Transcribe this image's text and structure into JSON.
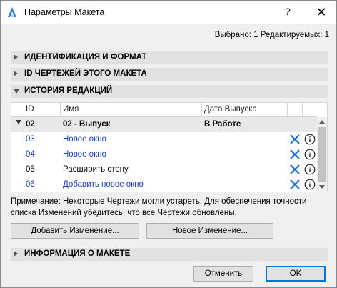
{
  "window": {
    "title": "Параметры Макета",
    "help_label": "?",
    "close_label": "✕"
  },
  "selection_info": "Выбрано: 1 Редактируемых: 1",
  "sections": [
    {
      "label": "ИДЕНТИФИКАЦИЯ И ФОРМАТ",
      "expanded": false
    },
    {
      "label": "ID ЧЕРТЕЖЕЙ ЭТОГО МАКЕТА",
      "expanded": false
    },
    {
      "label": "ИСТОРИЯ РЕДАКЦИЙ",
      "expanded": true
    },
    {
      "label": "ИНФОРМАЦИЯ О МАКЕТЕ",
      "expanded": false
    }
  ],
  "revision_table": {
    "columns": [
      "ID",
      "Имя",
      "Дата Выпуска"
    ],
    "group_row": {
      "id": "02",
      "name": "02 - Выпуск",
      "date": "В Работе"
    },
    "rows": [
      {
        "id": "03",
        "name": "Новое окно",
        "color": "#1c3cc8"
      },
      {
        "id": "04",
        "name": "Новое окно",
        "color": "#1c3cc8"
      },
      {
        "id": "05",
        "name": "Расширить стену",
        "color": "#000000"
      },
      {
        "id": "06",
        "name": "Добавить новое окно",
        "color": "#1c3cc8"
      }
    ],
    "row_icons": [
      "delete-x-icon",
      "info-icon"
    ]
  },
  "note": "Примечание: Некоторые Чертежи могли устареть. Для обеспечения точности списка Изменений убедитесь, что все Чертежи обновлены.",
  "buttons": {
    "add_change": "Добавить Изменение...",
    "new_change": "Новое Изменение...",
    "cancel": "Отменить",
    "ok": "OK"
  },
  "colors": {
    "accent": "#0078d7",
    "link_blue": "#1c3cc8",
    "icon_blue": "#1e6fd9"
  }
}
